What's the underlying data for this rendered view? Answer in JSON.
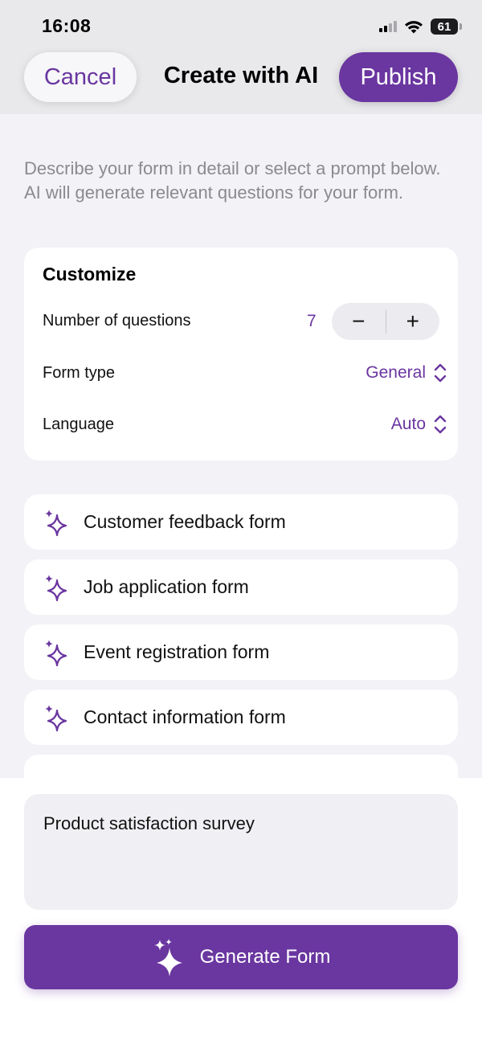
{
  "status_bar": {
    "time": "16:08",
    "battery": "61"
  },
  "nav": {
    "cancel_label": "Cancel",
    "title": "Create with AI",
    "publish_label": "Publish"
  },
  "intro_text": "Describe your form in detail or select a prompt below. AI will generate relevant questions for your form.",
  "customize": {
    "title": "Customize",
    "questions_label": "Number of questions",
    "questions_value": "7",
    "stepper_minus": "−",
    "stepper_plus": "+",
    "form_type_label": "Form type",
    "form_type_value": "General",
    "language_label": "Language",
    "language_value": "Auto"
  },
  "prompts": [
    "Customer feedback form",
    "Job application form",
    "Event registration form",
    "Contact information form"
  ],
  "input": {
    "value": "Product satisfaction survey"
  },
  "generate_label": "Generate Form",
  "colors": {
    "accent": "#6a36a0",
    "background": "#f2f2f7",
    "card": "#ffffff",
    "hint_text": "#8a8a8f"
  }
}
